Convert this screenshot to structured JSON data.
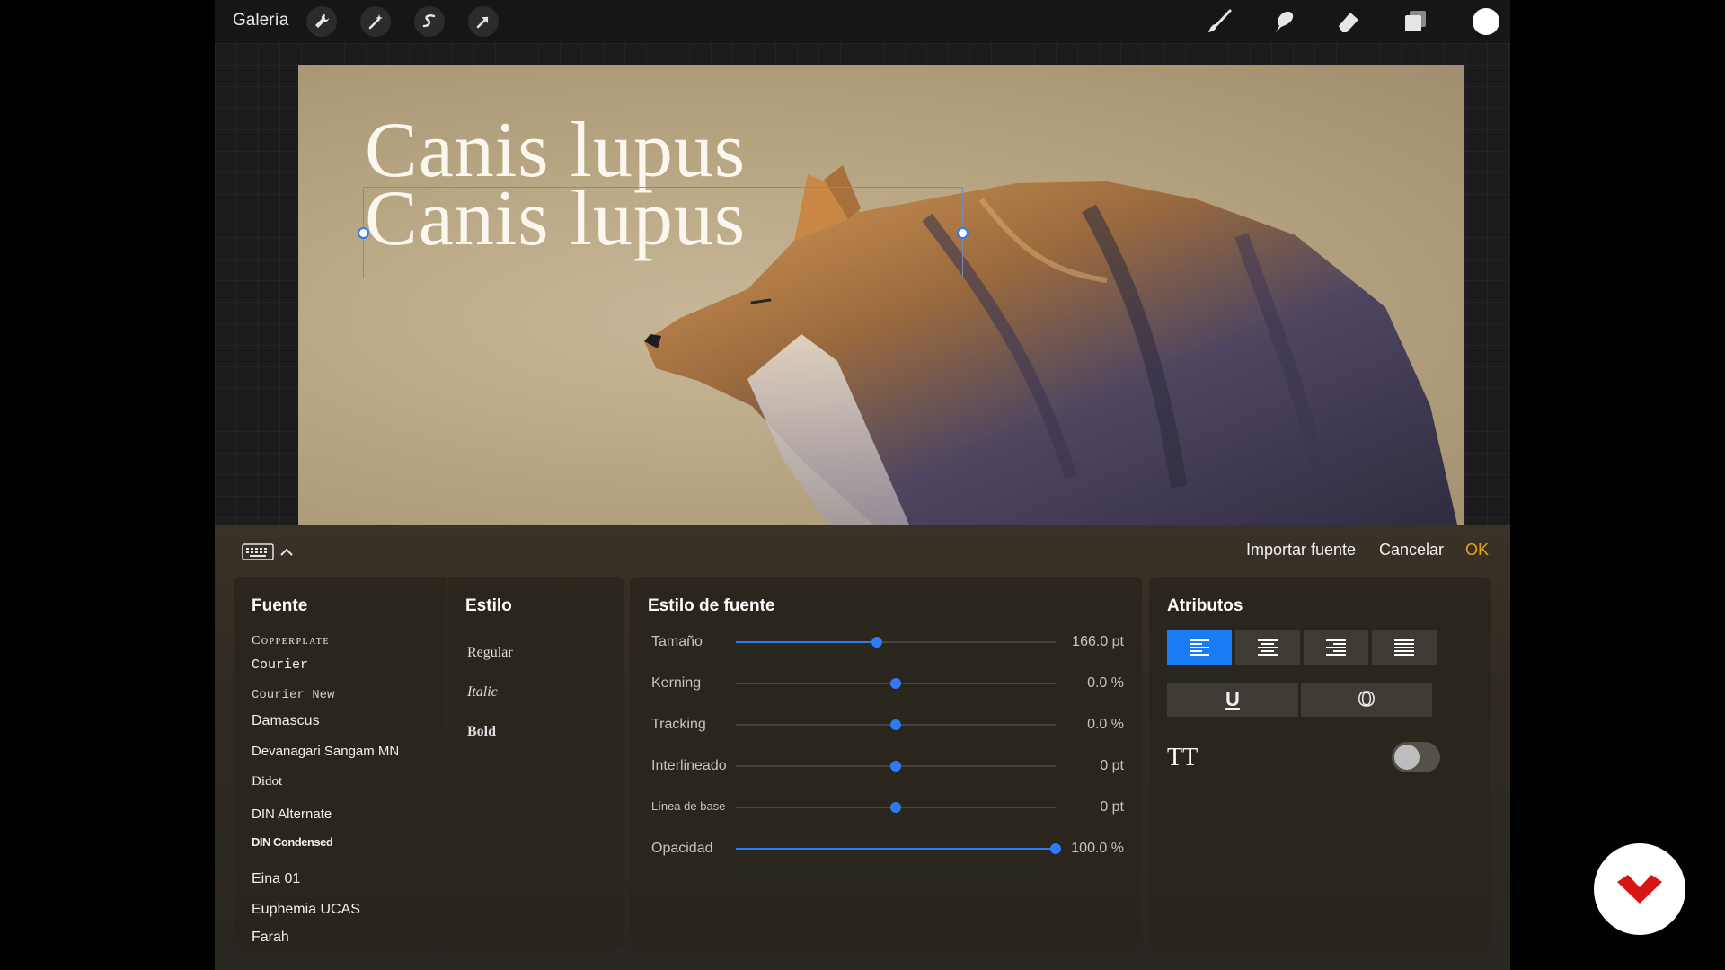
{
  "topbar": {
    "gallery_label": "Galería",
    "left_tools": [
      "wrench-icon",
      "magic-wand-icon",
      "selection-icon",
      "transform-arrow-icon"
    ],
    "right_tools": [
      "brush-icon",
      "smudge-icon",
      "eraser-icon",
      "layers-icon"
    ],
    "active_color": "#ffffff"
  },
  "canvas": {
    "text_line_1": "Canis lupus",
    "text_line_2": "Canis lupus"
  },
  "panel": {
    "import_font": "Importar fuente",
    "cancel": "Cancelar",
    "ok": "OK",
    "ok_color": "#e8a11a"
  },
  "fonts": {
    "title": "Fuente",
    "items": [
      "Copperplate",
      "Courier",
      "Courier New",
      "Damascus",
      "Devanagari Sangam MN",
      "Didot",
      "DIN Alternate",
      "DIN Condensed",
      "Eina 01",
      "Euphemia  UCAS",
      "Farah"
    ]
  },
  "styles": {
    "title": "Estilo",
    "items": [
      "Regular",
      "Italic",
      "Bold"
    ]
  },
  "font_style": {
    "title": "Estilo de fuente",
    "sliders": [
      {
        "label": "Tamaño",
        "value": "166.0 pt",
        "fraction": 0.44
      },
      {
        "label": "Kerning",
        "value": "0.0 %",
        "fraction": 0.5
      },
      {
        "label": "Tracking",
        "value": "0.0 %",
        "fraction": 0.5
      },
      {
        "label": "Interlineado",
        "value": "0 pt",
        "fraction": 0.5
      },
      {
        "label": "Línea de base",
        "value": "0 pt",
        "fraction": 0.5
      },
      {
        "label": "Opacidad",
        "value": "100.0 %",
        "fraction": 1.0
      }
    ]
  },
  "attributes": {
    "title": "Atributos",
    "align_options": [
      "align-left-icon",
      "align-center-icon",
      "align-right-icon",
      "justify-icon"
    ],
    "active_align": 0,
    "underline_label": "U",
    "outline_label": "O",
    "caps_label": "TT",
    "caps_enabled": false
  }
}
